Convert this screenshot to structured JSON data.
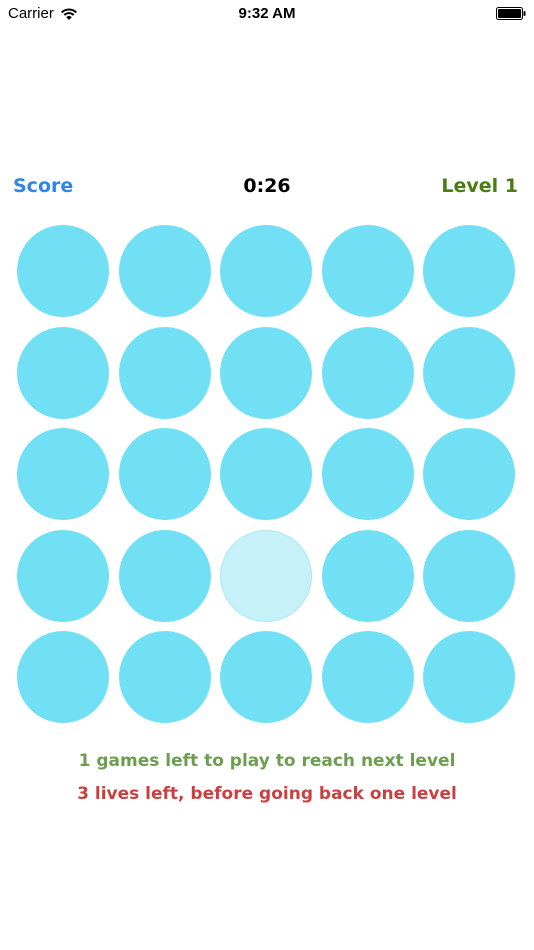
{
  "status_bar": {
    "carrier": "Carrier",
    "time": "9:32 AM",
    "icons": {
      "wifi": "wifi-icon",
      "battery": "battery-icon"
    }
  },
  "game": {
    "score_label": "Score",
    "timer": "0:26",
    "level_label": "Level 1",
    "colors": {
      "score": "#2f86ea",
      "level": "#4a7d12",
      "circle": "#72e0f4",
      "circle_faded": "#c6f1f9",
      "circle_faded_border": "#a9e8f4",
      "games_left": "#6d9e4f",
      "lives_left": "#cc3f3f"
    },
    "grid": {
      "rows": 5,
      "cols": 5,
      "faded_cells": [
        [
          3,
          2
        ]
      ]
    }
  },
  "messages": {
    "games_left": "1 games left to play to reach next level",
    "lives_left": "3 lives left, before going back one level"
  }
}
